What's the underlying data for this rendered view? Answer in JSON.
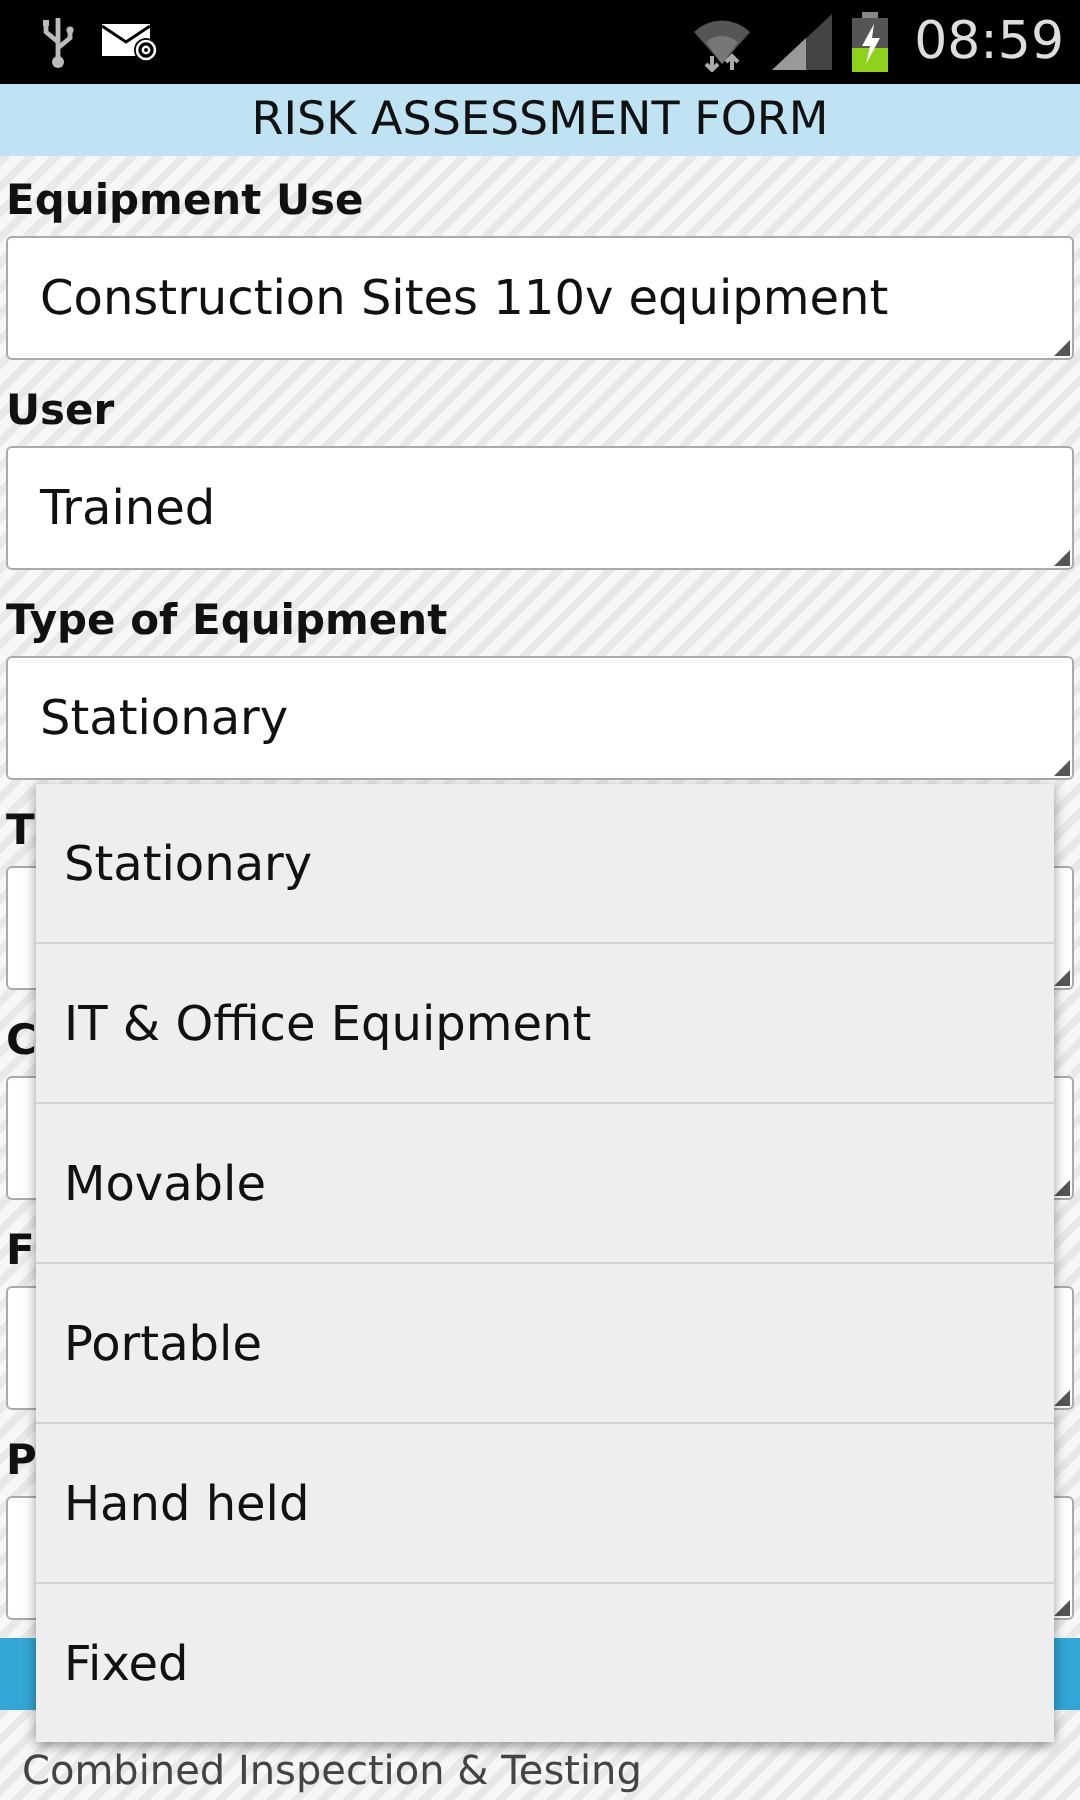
{
  "status_bar": {
    "time": "08:59"
  },
  "title": "RISK ASSESSMENT FORM",
  "fields": [
    {
      "label": "Equipment Use",
      "value": "Construction Sites 110v equipment"
    },
    {
      "label": "User",
      "value": "Trained"
    },
    {
      "label": "Type of Equipment",
      "value": "Stationary"
    },
    {
      "label": "T"
    },
    {
      "label": "C"
    },
    {
      "label": "F"
    },
    {
      "label": "P"
    }
  ],
  "bottom_text": "Combined Inspection & Testing",
  "dropdown": {
    "options": [
      "Stationary",
      "IT & Office Equipment",
      "Movable",
      "Portable",
      "Hand held",
      "Fixed"
    ]
  }
}
